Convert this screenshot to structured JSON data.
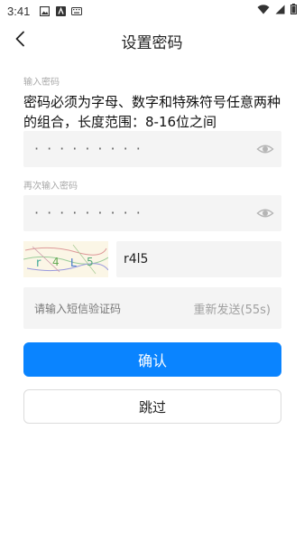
{
  "status_bar": {
    "time": "3:41"
  },
  "header": {
    "title": "设置密码"
  },
  "password": {
    "label": "输入密码",
    "hint": "密码必须为字母、数字和特殊符号任意两种的组合，长度范围：8-16位之间",
    "masked_value": "·········"
  },
  "confirm_password": {
    "label": "再次输入密码",
    "masked_value": "·········"
  },
  "captcha": {
    "image_text": "r4L5",
    "input_value": "r4l5"
  },
  "sms": {
    "placeholder": "请输入短信验证码",
    "resend_label": "重新发送(55s)"
  },
  "buttons": {
    "confirm": "确认",
    "skip": "跳过"
  },
  "colors": {
    "accent": "#0a84ff"
  },
  "icons": [
    "back-arrow-icon",
    "eye-icon",
    "wifi-icon",
    "signal-icon",
    "battery-icon"
  ]
}
